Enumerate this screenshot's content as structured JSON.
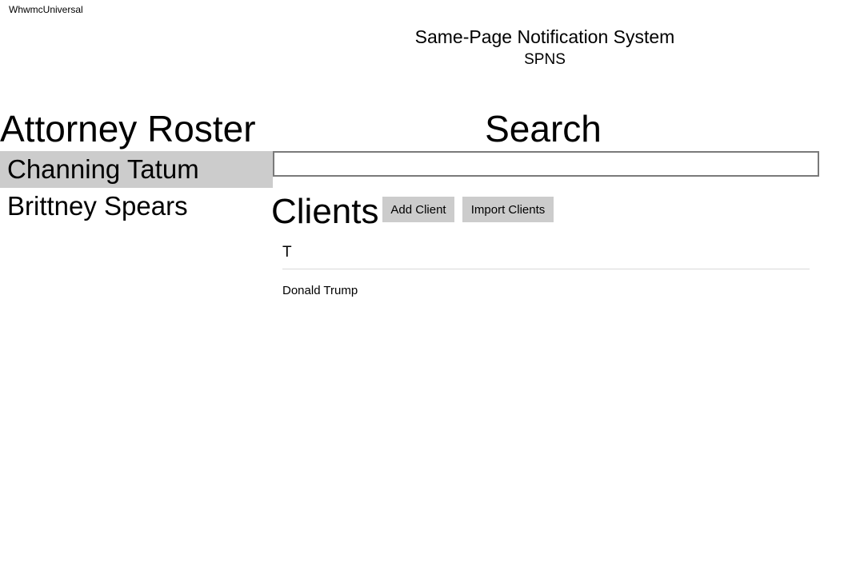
{
  "app": {
    "title": "WhwmcUniversal"
  },
  "header": {
    "title": "Same-Page Notification System",
    "subtitle": "SPNS"
  },
  "roster": {
    "heading": "Attorney Roster",
    "items": [
      {
        "label": "Channing Tatum",
        "selected": true
      },
      {
        "label": "Brittney Spears",
        "selected": false
      }
    ]
  },
  "search": {
    "heading": "Search",
    "value": "",
    "placeholder": ""
  },
  "clients": {
    "heading": "Clients",
    "add_label": "Add Client",
    "import_label": "Import Clients",
    "groups": [
      {
        "letter": "T",
        "items": [
          "Donald Trump"
        ]
      }
    ]
  },
  "colors": {
    "selected_bg": "#cccccc",
    "button_bg": "#cccccc",
    "input_border": "#7a7a7a",
    "divider": "#d9d9d9"
  }
}
